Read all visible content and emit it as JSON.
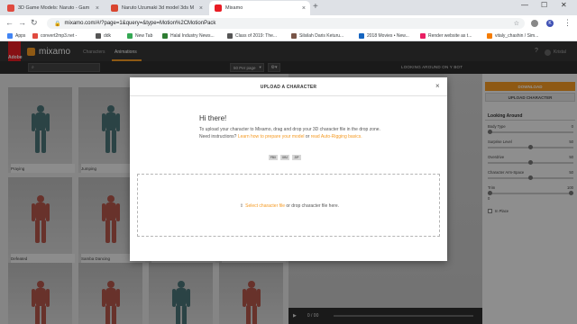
{
  "browser": {
    "tabs": [
      {
        "title": "3D Game Models: Naruto - Gam",
        "favicon_color": "#e04a3f"
      },
      {
        "title": "Naruto Uzumaki 3d model 3ds M",
        "favicon_color": "#d9452f"
      },
      {
        "title": "Mixamo",
        "favicon_color": "#e91c24"
      }
    ],
    "new_tab": "+",
    "window_controls": {
      "minimize": "—",
      "maximize": "☐",
      "close": "✕"
    },
    "address": "mixamo.com/#/?page=1&query=&type=Motion%2CMotionPack",
    "bookmarks": [
      {
        "label": "Apps",
        "color": "#4285f4"
      },
      {
        "label": "convert2mp3.net -",
        "color": "#e04a3f"
      },
      {
        "label": "ddk",
        "color": "#555555"
      },
      {
        "label": "New Tab",
        "color": "#34a853"
      },
      {
        "label": "Halal Industry News...",
        "color": "#2e7d32"
      },
      {
        "label": "Class of 2019: The...",
        "color": "#555555"
      },
      {
        "label": "Silsilah Daris Keturu...",
        "color": "#795548"
      },
      {
        "label": "2018 Movies • New...",
        "color": "#1565c0"
      },
      {
        "label": "Render website as t...",
        "color": "#e91e63"
      },
      {
        "label": "vitaly_chashin / Sim...",
        "color": "#f57c00"
      }
    ],
    "profile_initial": "K"
  },
  "app": {
    "adobe_label": "Adobe",
    "logo": "mixamo",
    "nav": {
      "characters": "Characters",
      "animations": "Animations"
    },
    "accent": "#f59a23",
    "user": "Kristal"
  },
  "toolbar": {
    "per_page": "50 Per page",
    "view_title": "LOOKING AROUND ON Y BOT"
  },
  "grid": {
    "cards": [
      {
        "label": "Praying",
        "tone": "teal"
      },
      {
        "label": "Jumping",
        "tone": "teal"
      },
      {
        "label": "",
        "tone": "teal"
      },
      {
        "label": "",
        "tone": "teal"
      },
      {
        "label": "Defeated",
        "tone": "red"
      },
      {
        "label": "Samba Dancing",
        "tone": "red"
      },
      {
        "label": "",
        "tone": "red"
      },
      {
        "label": "",
        "tone": "red"
      },
      {
        "label": "",
        "tone": "red"
      },
      {
        "label": "",
        "tone": "red"
      },
      {
        "label": "",
        "tone": "teal"
      },
      {
        "label": "",
        "tone": "red"
      }
    ]
  },
  "viewer": {
    "play": "▶",
    "frame": "0 / 00"
  },
  "panel": {
    "download": "DOWNLOAD",
    "upload": "UPLOAD CHARACTER",
    "title": "Looking Around",
    "params": [
      {
        "label": "Body Type",
        "value": "0",
        "fraction": 0.0
      },
      {
        "label": "Surprise Level",
        "value": "50",
        "fraction": 0.5
      },
      {
        "label": "Overdrive",
        "value": "50",
        "fraction": 0.5
      },
      {
        "label": "Character Arm-Space",
        "value": "50",
        "fraction": 0.5
      },
      {
        "label": "Trim",
        "value": "100",
        "fraction": 1.0
      }
    ],
    "trim_sub": "0",
    "in_place": "In Place"
  },
  "modal": {
    "title": "UPLOAD A CHARACTER",
    "close": "×",
    "greeting": "Hi there!",
    "body_1": "To upload your character to Mixamo, drag and drop your 3D character file in the drop zone. Need instructions? ",
    "link_1": "Learn how to prepare your model",
    "body_2": " or ",
    "link_2": "read Auto-Rigging basics.",
    "formats": [
      "FBX",
      "OBJ",
      "ZIP"
    ],
    "drop_link": "Select character file",
    "drop_rest": " or drop character file here."
  }
}
